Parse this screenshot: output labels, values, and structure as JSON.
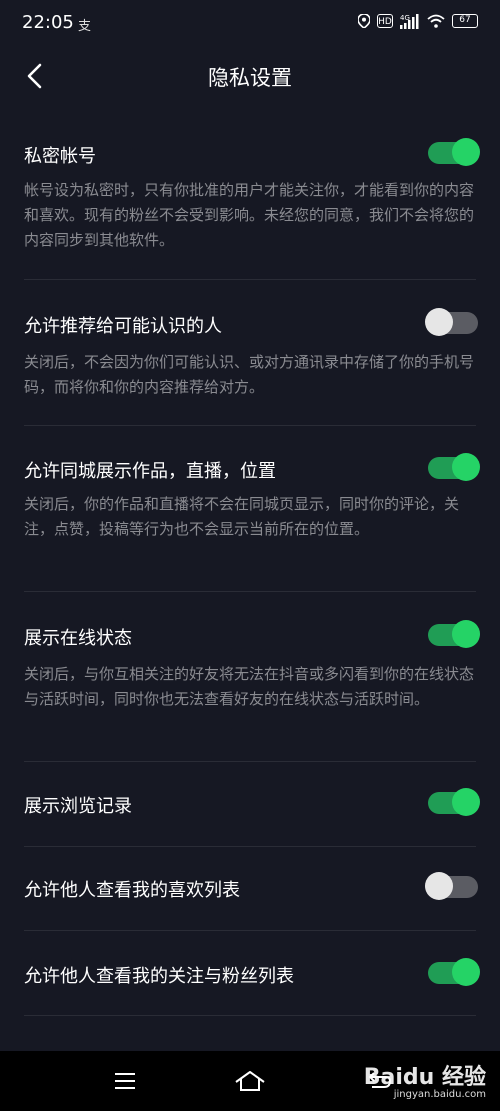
{
  "status": {
    "time": "22:05",
    "sub": "支",
    "battery": "67",
    "hd": "HD"
  },
  "title": "隐私设置",
  "settings": [
    {
      "label": "私密帐号",
      "on": true,
      "desc": "帐号设为私密时，只有你批准的用户才能关注你，才能看到你的内容和喜欢。现有的粉丝不会受到影响。未经您的同意，我们不会将您的内容同步到其他软件。"
    },
    {
      "label": "允许推荐给可能认识的人",
      "on": false,
      "desc": "关闭后，不会因为你们可能认识、或对方通讯录中存储了你的手机号码，而将你和你的内容推荐给对方。"
    },
    {
      "label": "允许同城展示作品，直播，位置",
      "on": true,
      "desc": "关闭后，你的作品和直播将不会在同城页显示，同时你的评论，关注，点赞，投稿等行为也不会显示当前所在的位置。"
    },
    {
      "label": "展示在线状态",
      "on": true,
      "desc": "关闭后，与你互相关注的好友将无法在抖音或多闪看到你的在线状态与活跃时间，同时你也无法查看好友的在线状态与活跃时间。"
    },
    {
      "label": "展示浏览记录",
      "on": true
    },
    {
      "label": "允许他人查看我的喜欢列表",
      "on": false
    },
    {
      "label": "允许他人查看我的关注与粉丝列表",
      "on": true
    }
  ],
  "watermark": {
    "logo": "Baidu 经验",
    "url": "jingyan.baidu.com"
  }
}
